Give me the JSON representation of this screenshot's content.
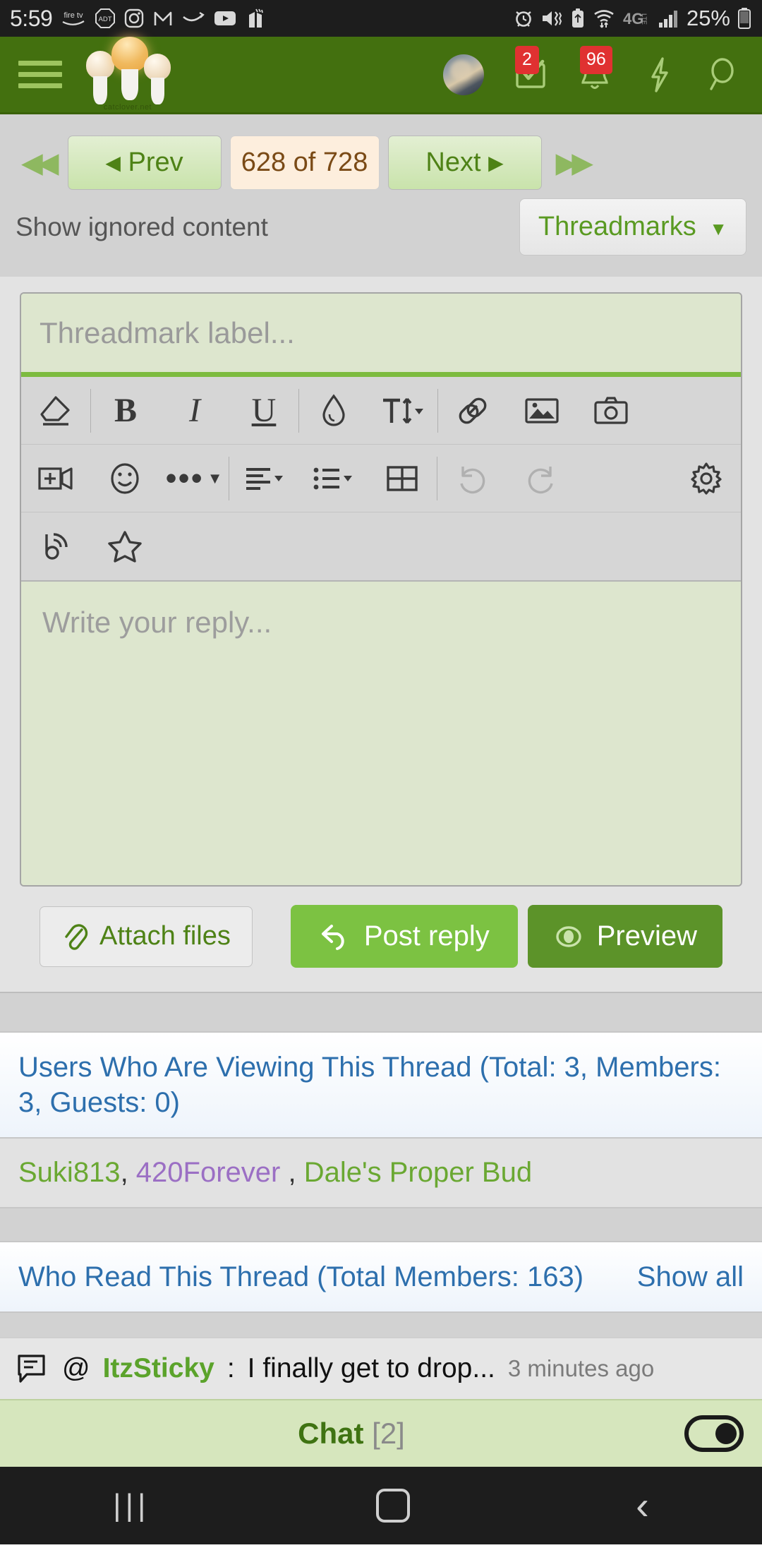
{
  "statusbar": {
    "time": "5:59",
    "battery_percent": "25%",
    "left_icons": [
      "firetv-icon",
      "adt-icon",
      "instagram-icon",
      "gmail-icon",
      "amazon-icon",
      "youtube-icon",
      "app-icon"
    ],
    "right_icons": [
      "alarm-icon",
      "vibrate-icon",
      "battery-saver-icon",
      "wifi-icon",
      "4glte-icon",
      "signal-bars-icon",
      "battery-icon"
    ],
    "network": "4G LTE"
  },
  "header": {
    "menu": "menu-icon",
    "logo_text": "catclover.net",
    "avatar": "user-avatar",
    "inbox_badge": "2",
    "alerts_badge": "96",
    "accent": "#43700f"
  },
  "pagination": {
    "first_label": "◀◀",
    "prev_label": "Prev",
    "current_label": "628 of 728",
    "next_label": "Next",
    "last_label": "▶▶",
    "current_page": "628",
    "total_pages": "728"
  },
  "subrow": {
    "show_ignored": "Show ignored content",
    "threadmarks": "Threadmarks"
  },
  "editor": {
    "threadmark_placeholder": "Threadmark label...",
    "reply_placeholder": "Write your reply...",
    "toolbar_rows": [
      [
        "eraser-icon",
        "bold-icon",
        "italic-icon",
        "underline-icon",
        "text-color-icon",
        "font-size-icon",
        "link-icon",
        "image-icon",
        "camera-icon"
      ],
      [
        "video-icon",
        "emoji-icon",
        "more-options-icon",
        "align-icon",
        "list-icon",
        "table-icon",
        "undo-icon",
        "redo-icon",
        "settings-icon"
      ],
      [
        "bbcode-icon",
        "star-icon"
      ]
    ],
    "bold": "B",
    "italic": "I",
    "underline": "U",
    "font_size": "T"
  },
  "actions": {
    "attach": "Attach files",
    "post_reply": "Post reply",
    "preview": "Preview",
    "post_color": "#7cc242",
    "preview_color": "#5c9329"
  },
  "viewers": {
    "heading": "Users Who Are Viewing This Thread (Total: 3, Members: 3, Guests: 0)",
    "total": "3",
    "members": "3",
    "guests": "0",
    "names": [
      {
        "name": "Suki813",
        "color": "green"
      },
      {
        "name": "420Forever",
        "color": "purple"
      },
      {
        "name": "Dale's Proper Bud",
        "color": "green"
      }
    ]
  },
  "readers": {
    "heading": "Who Read This Thread (Total Members: 163)",
    "total_members": "163",
    "show_all": "Show all"
  },
  "chat": {
    "message_at": "@",
    "message_user": "ItzSticky",
    "message_colon": ":",
    "message_text": "I finally get to drop...",
    "message_time": "3 minutes ago",
    "title": "Chat",
    "count": "[2]",
    "toggle_state": "on"
  },
  "navbar": {
    "recents": "|||",
    "home": "home-button",
    "back": "‹"
  }
}
